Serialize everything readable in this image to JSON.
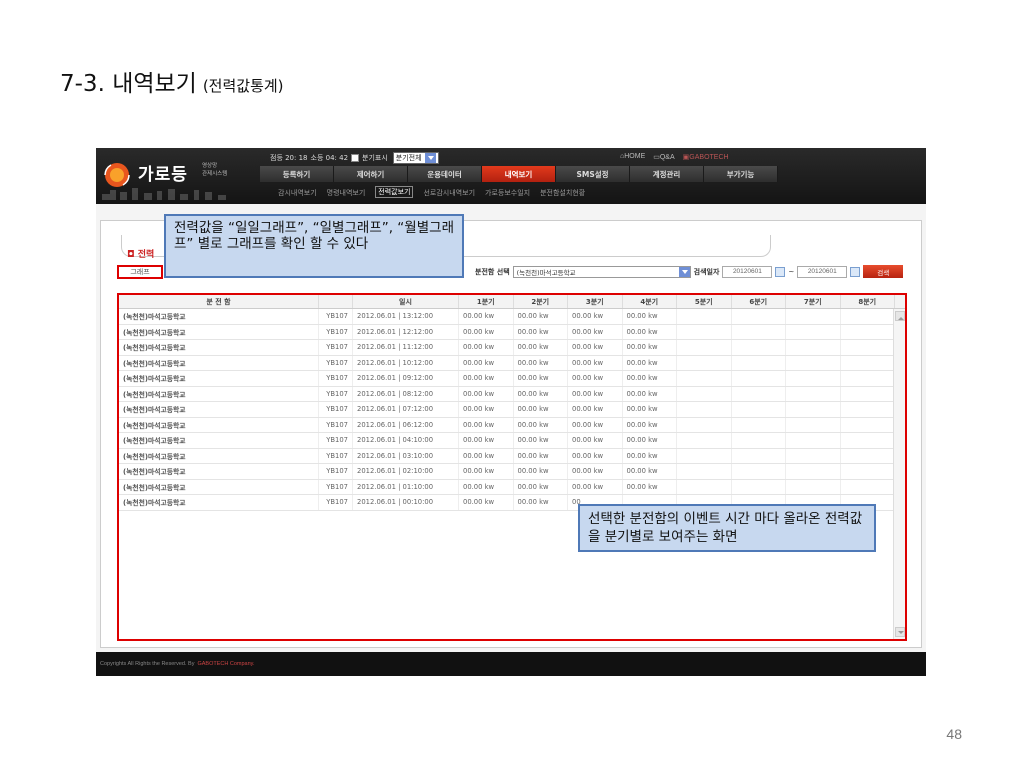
{
  "slide": {
    "title": "7-3. 내역보기",
    "subtitle": "(전력값통계)",
    "page_number": "48"
  },
  "app": {
    "logo_text": "가로등",
    "logo_sub_line1": "영상망",
    "logo_sub_line2": "관제시스템",
    "status": {
      "text1": "점등 20: 18",
      "text2": "소등 04: 42",
      "checkbox_label": "분기표시",
      "select_value": "분기전체"
    },
    "top_links": [
      "HOME",
      "Q&A",
      "GABOTECH"
    ],
    "nav": [
      "등록하기",
      "제어하기",
      "운용데이터",
      "내역보기",
      "SMS설정",
      "계정관리",
      "부가기능"
    ],
    "nav_active": "내역보기",
    "sub_nav": [
      "감시내역보기",
      "명령내역보기",
      "전력값보기",
      "선로감시내역보기",
      "가로등보수일지",
      "분전함설치현황"
    ],
    "sub_nav_active": "전력값보기",
    "section_title": "전력",
    "graph_button": "그래프",
    "filter": {
      "label": "분전함 선택",
      "value": "(녹천천)마석고등학교",
      "date_label": "검색일자",
      "date_from": "20120601",
      "tilde": "~",
      "date_to": "20120601",
      "search_button": "검색"
    },
    "table": {
      "headers": [
        "분 전 함",
        "",
        "일시",
        "1분기",
        "2분기",
        "3분기",
        "4분기",
        "5분기",
        "6분기",
        "7분기",
        "8분기"
      ],
      "rows": [
        [
          "(녹천천)마석고등학교",
          "YB107",
          "2012.06.01 | 13:12:00",
          "00.00 kw",
          "00.00 kw",
          "00.00 kw",
          "00.00 kw",
          "",
          "",
          "",
          ""
        ],
        [
          "(녹천천)마석고등학교",
          "YB107",
          "2012.06.01 | 12:12:00",
          "00.00 kw",
          "00.00 kw",
          "00.00 kw",
          "00.00 kw",
          "",
          "",
          "",
          ""
        ],
        [
          "(녹천천)마석고등학교",
          "YB107",
          "2012.06.01 | 11:12:00",
          "00.00 kw",
          "00.00 kw",
          "00.00 kw",
          "00.00 kw",
          "",
          "",
          "",
          ""
        ],
        [
          "(녹천천)마석고등학교",
          "YB107",
          "2012.06.01 | 10:12:00",
          "00.00 kw",
          "00.00 kw",
          "00.00 kw",
          "00.00 kw",
          "",
          "",
          "",
          ""
        ],
        [
          "(녹천천)마석고등학교",
          "YB107",
          "2012.06.01 | 09:12:00",
          "00.00 kw",
          "00.00 kw",
          "00.00 kw",
          "00.00 kw",
          "",
          "",
          "",
          ""
        ],
        [
          "(녹천천)마석고등학교",
          "YB107",
          "2012.06.01 | 08:12:00",
          "00.00 kw",
          "00.00 kw",
          "00.00 kw",
          "00.00 kw",
          "",
          "",
          "",
          ""
        ],
        [
          "(녹천천)마석고등학교",
          "YB107",
          "2012.06.01 | 07:12:00",
          "00.00 kw",
          "00.00 kw",
          "00.00 kw",
          "00.00 kw",
          "",
          "",
          "",
          ""
        ],
        [
          "(녹천천)마석고등학교",
          "YB107",
          "2012.06.01 | 06:12:00",
          "00.00 kw",
          "00.00 kw",
          "00.00 kw",
          "00.00 kw",
          "",
          "",
          "",
          ""
        ],
        [
          "(녹천천)마석고등학교",
          "YB107",
          "2012.06.01 | 04:10:00",
          "00.00 kw",
          "00.00 kw",
          "00.00 kw",
          "00.00 kw",
          "",
          "",
          "",
          ""
        ],
        [
          "(녹천천)마석고등학교",
          "YB107",
          "2012.06.01 | 03:10:00",
          "00.00 kw",
          "00.00 kw",
          "00.00 kw",
          "00.00 kw",
          "",
          "",
          "",
          ""
        ],
        [
          "(녹천천)마석고등학교",
          "YB107",
          "2012.06.01 | 02:10:00",
          "00.00 kw",
          "00.00 kw",
          "00.00 kw",
          "00.00 kw",
          "",
          "",
          "",
          ""
        ],
        [
          "(녹천천)마석고등학교",
          "YB107",
          "2012.06.01 | 01:10:00",
          "00.00 kw",
          "00.00 kw",
          "00.00 kw",
          "00.00 kw",
          "",
          "",
          "",
          ""
        ],
        [
          "(녹천천)마석고등학교",
          "YB107",
          "2012.06.01 | 00:10:00",
          "00.00 kw",
          "00.00 kw",
          "00",
          "",
          "",
          "",
          "",
          ""
        ]
      ]
    },
    "footer_text": "Copyrights All Rights the Reserved. By",
    "footer_brand": "GABOTECH Company."
  },
  "callouts": {
    "graph_note": "전력값을 “일일그래프”, “일별그래프”, “월별그래프” 별로 그래프를 확인 할 수 있다",
    "table_note": "선택한 분전함의 이벤트 시간 마다 올라온 전력값을 분기별로 보여주는 화면"
  },
  "colors": {
    "active_nav": "#d0301a",
    "highlight_border": "#dd0000",
    "callout_fill": "#c7d8ef",
    "callout_border": "#4f79b7"
  }
}
